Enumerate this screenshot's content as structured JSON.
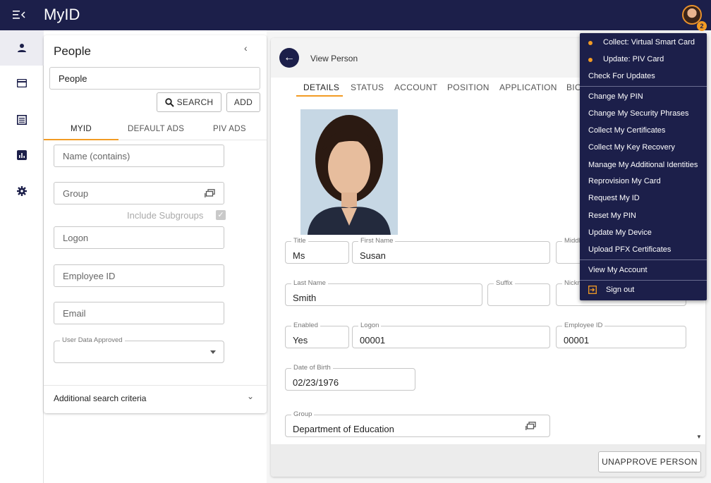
{
  "app": {
    "title": "MyID",
    "notification_count": "2"
  },
  "rail": {
    "items": [
      "people-icon",
      "card-icon",
      "report-icon",
      "chart-icon",
      "gear-icon"
    ]
  },
  "people_panel": {
    "title": "People",
    "category": "People",
    "search_label": "SEARCH",
    "add_label": "ADD",
    "tabs": [
      "MYID",
      "DEFAULT ADS",
      "PIV ADS"
    ],
    "fields": {
      "name_placeholder": "Name (contains)",
      "group_placeholder": "Group",
      "include_subgroups": "Include Subgroups",
      "logon_placeholder": "Logon",
      "employee_id_placeholder": "Employee ID",
      "email_placeholder": "Email",
      "user_data_approved_label": "User Data Approved",
      "user_data_approved_value": ""
    },
    "additional_criteria": "Additional search criteria"
  },
  "view_person": {
    "title": "View Person",
    "tabs": [
      "DETAILS",
      "STATUS",
      "ACCOUNT",
      "POSITION",
      "APPLICATION",
      "BIO"
    ],
    "fields": {
      "title_label": "Title",
      "title_value": "Ms",
      "first_name_label": "First Name",
      "first_name_value": "Susan",
      "middle_label": "Middle",
      "last_name_label": "Last Name",
      "last_name_value": "Smith",
      "suffix_label": "Suffix",
      "suffix_value": "",
      "nickname_label": "Nickname",
      "enabled_label": "Enabled",
      "enabled_value": "Yes",
      "logon_label": "Logon",
      "logon_value": "00001",
      "employee_id_label": "Employee ID",
      "employee_id_value": "00001",
      "dob_label": "Date of Birth",
      "dob_value": "02/23/1976",
      "group_label": "Group",
      "group_value": "Department of Education"
    },
    "unapprove_label": "UNAPPROVE PERSON"
  },
  "user_menu": {
    "pending": [
      "Collect: Virtual Smart Card",
      "Update: PIV Card"
    ],
    "check_updates": "Check For Updates",
    "actions": [
      "Change My PIN",
      "Change My Security Phrases",
      "Collect My Certificates",
      "Collect My Key Recovery",
      "Manage My Additional Identities",
      "Reprovision My Card",
      "Request My ID",
      "Reset My PIN",
      "Update My Device",
      "Upload PFX Certificates"
    ],
    "view_account": "View My Account",
    "sign_out": "Sign out"
  },
  "colors": {
    "navy": "#1c1f4a",
    "accent": "#f29b24"
  }
}
